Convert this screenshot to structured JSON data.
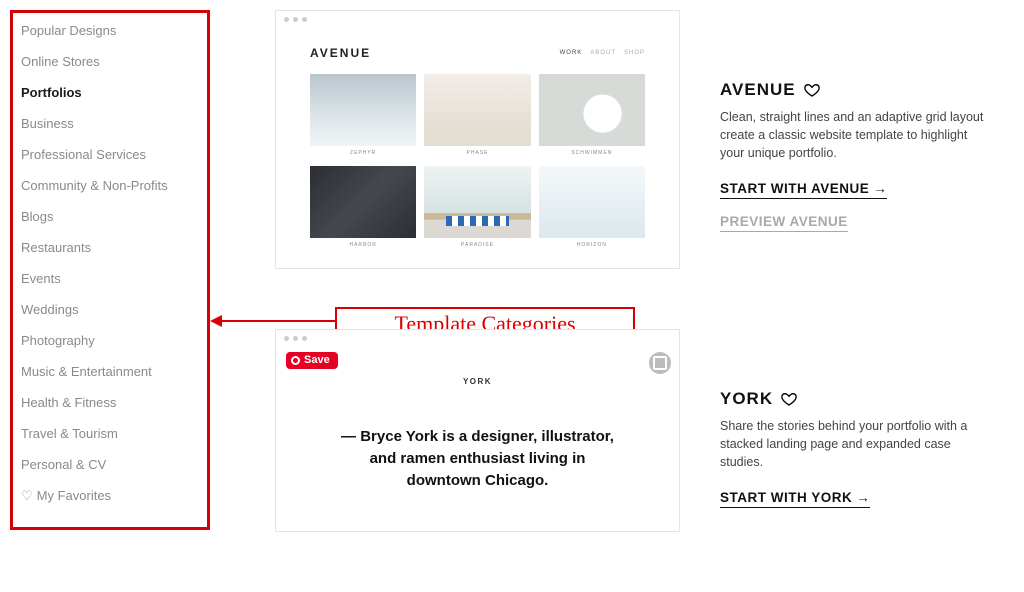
{
  "sidebar": {
    "items": [
      {
        "label": "Popular Designs",
        "active": false
      },
      {
        "label": "Online Stores",
        "active": false
      },
      {
        "label": "Portfolios",
        "active": true
      },
      {
        "label": "Business",
        "active": false
      },
      {
        "label": "Professional Services",
        "active": false
      },
      {
        "label": "Community & Non-Profits",
        "active": false
      },
      {
        "label": "Blogs",
        "active": false
      },
      {
        "label": "Restaurants",
        "active": false
      },
      {
        "label": "Events",
        "active": false
      },
      {
        "label": "Weddings",
        "active": false
      },
      {
        "label": "Photography",
        "active": false
      },
      {
        "label": "Music & Entertainment",
        "active": false
      },
      {
        "label": "Health & Fitness",
        "active": false
      },
      {
        "label": "Travel & Tourism",
        "active": false
      },
      {
        "label": "Personal & CV",
        "active": false
      }
    ],
    "favorites_label": "My Favorites"
  },
  "callout": {
    "label": "Template Categories"
  },
  "templates": {
    "avenue": {
      "name": "AVENUE",
      "nav": [
        "WORK",
        "ABOUT",
        "SHOP"
      ],
      "captions": [
        "ZEPHYR",
        "PHASE",
        "SCHWIMMEN",
        "HARBOR",
        "PARADISE",
        "HORIZON"
      ],
      "description": "Clean, straight lines and an adaptive grid layout create a classic website template to highlight your unique portfolio.",
      "start_label": "START WITH AVENUE",
      "preview_label": "PREVIEW AVENUE"
    },
    "york": {
      "name": "YORK",
      "save_label": "Save",
      "intro_prefix": "— ",
      "intro": "Bryce York is a designer, illustrator, and ramen enthusiast living in downtown Chicago.",
      "description": "Share the stories behind your portfolio with a stacked landing page and expanded case studies.",
      "start_label": "START WITH YORK"
    }
  }
}
